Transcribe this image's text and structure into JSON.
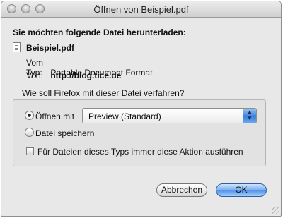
{
  "window": {
    "title": "Öffnen von Beispiel.pdf"
  },
  "heading": "Sie möchten folgende Datei herunterladen:",
  "file": {
    "name": "Beispiel.pdf",
    "type_label": "Vom Typ:",
    "type_value": "Portable Document Format",
    "from_label": "Von:",
    "from_value": "http://blog.tice.de"
  },
  "question": "Wie soll Firefox mit dieser Datei verfahren?",
  "options": {
    "open_label": "Öffnen mit",
    "open_selected": true,
    "open_with_value": "Preview (Standard)",
    "save_label": "Datei speichern",
    "save_selected": false,
    "always_label": "Für Dateien dieses Typs immer diese Aktion ausführen",
    "always_checked": false
  },
  "buttons": {
    "cancel": "Abbrechen",
    "ok": "OK"
  }
}
